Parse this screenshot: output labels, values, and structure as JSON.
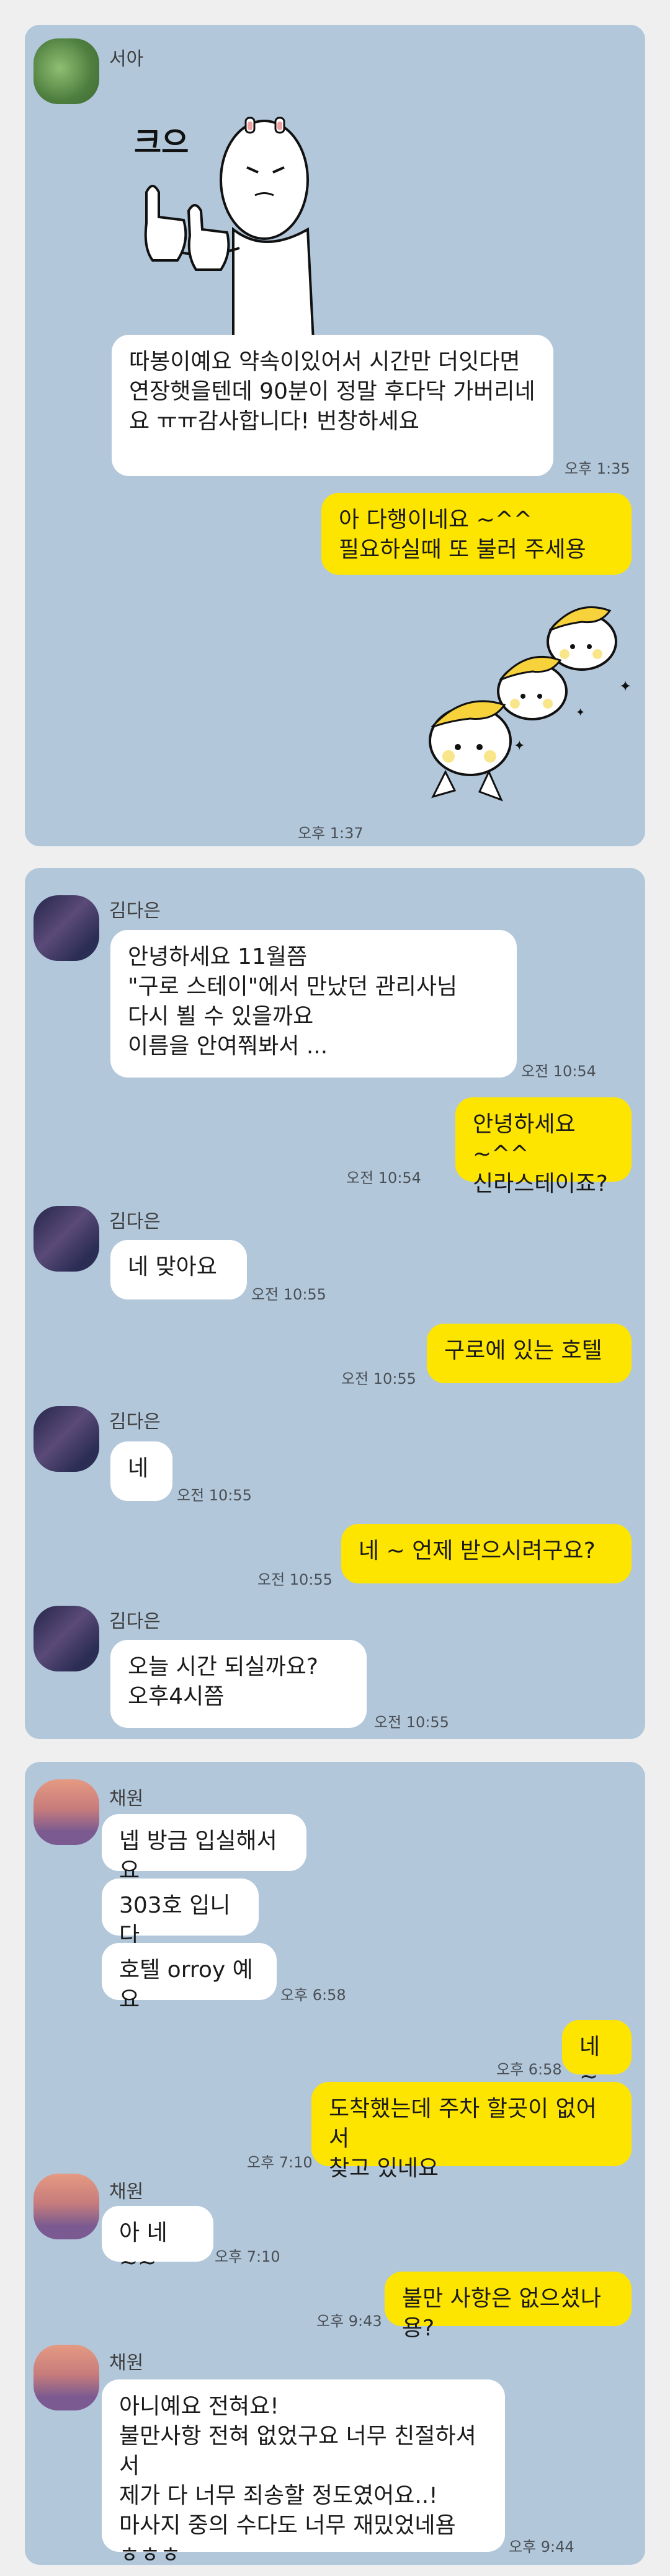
{
  "colors": {
    "panel": "#b2c7da",
    "outgoing": "#fee500",
    "incoming": "#ffffff",
    "page": "#efefef"
  },
  "panel1": {
    "sender": "서아",
    "sticker_caption": "크으",
    "msg1": "따봉이예요 약속이있어서 시간만 더잇다면 연장햇을텐데 90분이 정말 후다닥 가버리네요 ㅠㅠ감사합니다! 번창하세요",
    "time1": "오후 1:35",
    "msg2": "아 다행이네요 ~^^\n필요하실때 또 불러 주세용",
    "time2": "오후 1:37"
  },
  "panel2": {
    "sender": "김다은",
    "msg1": "안녕하세요 11월쯤\n\"구로 스테이\"에서 만났던 관리사님\n다시 뵐 수 있을까요\n이름을 안여쭤봐서 ...",
    "time1": "오전 10:54",
    "msg2": "안녕하세요 ~^^\n신라스테이죠?",
    "time2": "오전 10:54",
    "msg3": "네 맞아요",
    "time3": "오전 10:55",
    "msg4": "구로에 있는 호텔",
    "time4": "오전 10:55",
    "msg5": "네",
    "time5": "오전 10:55",
    "msg6": "네 ~ 언제 받으시려구요?",
    "time6": "오전 10:55",
    "msg7": "오늘  시간 되실까요?\n오후4시쯤",
    "time7": "오전 10:55"
  },
  "panel3": {
    "sender": "채원",
    "msg1": "넵 방금 입실해서요",
    "msg2": "303호 입니다",
    "msg3": "호텔 orroy 예요",
    "time3": "오후 6:58",
    "msg4": "네 ~",
    "time4": "오후 6:58",
    "msg5": "도착했는데  주차 할곳이 없어서\n찾고 있네요",
    "time5": "오후 7:10",
    "msg6": "아 네~~",
    "time6": "오후 7:10",
    "msg7": "불만 사항은 없으셨나용?",
    "time7": "오후 9:43",
    "msg8": "아니예요 전혀요!\n불만사항 전혀 없었구요 너무 친절하셔서\n제가 다 너무 죄송할 정도였어요..!\n마사지 중의 수다도 너무 재밌었네욤\nㅎㅎㅎ",
    "time8": "오후 9:44"
  }
}
